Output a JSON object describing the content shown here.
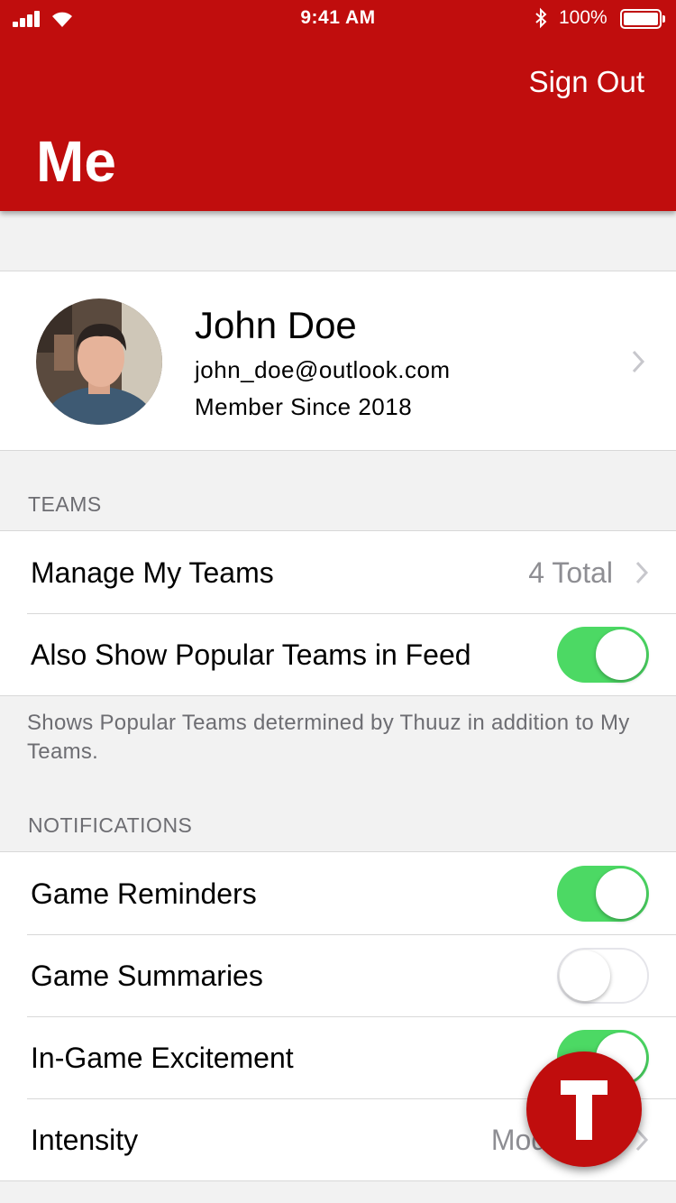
{
  "status_bar": {
    "time": "9:41 AM",
    "battery_percent": "100%"
  },
  "header": {
    "sign_out_label": "Sign Out",
    "title": "Me",
    "color": "#c00d0d"
  },
  "profile": {
    "name": "John Doe",
    "email": "john_doe@outlook.com",
    "member_since": "Member Since 2018"
  },
  "teams_section": {
    "header": "TEAMS",
    "rows": [
      {
        "label": "Manage My Teams",
        "value": "4 Total"
      },
      {
        "label": "Also Show Popular Teams in Feed",
        "toggle": true
      }
    ],
    "footnote": "Shows Popular Teams determined by Thuuz in addition to My Teams."
  },
  "notifications_section": {
    "header": "NOTIFICATIONS",
    "rows": [
      {
        "label": "Game Reminders",
        "toggle": true
      },
      {
        "label": "Game Summaries",
        "toggle": false
      },
      {
        "label": "In-Game Excitement",
        "toggle": true
      },
      {
        "label": "Intensity",
        "value": "Moderate"
      }
    ]
  },
  "accent_colors": {
    "toggle_on": "#4cd964",
    "brand_red": "#c00d0d"
  },
  "icons": [
    "signal-icon",
    "wifi-icon",
    "bluetooth-icon",
    "battery-icon",
    "chevron-right-icon",
    "thuuz-logo-icon"
  ]
}
